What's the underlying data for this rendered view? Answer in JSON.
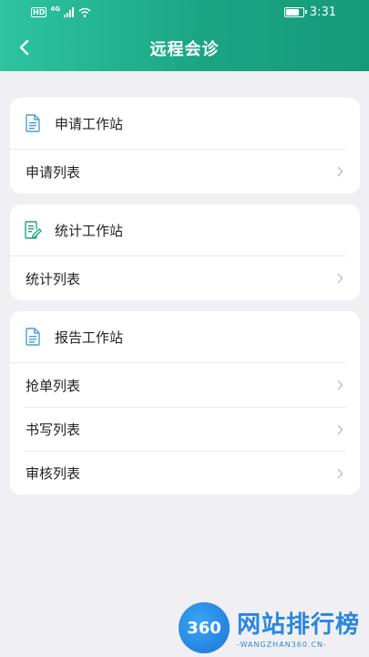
{
  "status_bar": {
    "hd": "HD",
    "network": "4G",
    "time": "3:31"
  },
  "header": {
    "title": "远程会诊"
  },
  "sections": [
    {
      "title": "申请工作站",
      "icon": "document-icon",
      "items": [
        {
          "label": "申请列表"
        }
      ]
    },
    {
      "title": "统计工作站",
      "icon": "edit-document-icon",
      "items": [
        {
          "label": "统计列表"
        }
      ]
    },
    {
      "title": "报告工作站",
      "icon": "document-icon",
      "items": [
        {
          "label": "抢单列表"
        },
        {
          "label": "书写列表"
        },
        {
          "label": "审核列表"
        }
      ]
    }
  ],
  "watermark": {
    "logo": "360",
    "title": "网站排行榜",
    "subtitle": "-WANGZHAN360.CN-"
  },
  "colors": {
    "header_start": "#2ec4a0",
    "header_end": "#179a7a",
    "icon_blue": "#4a9fd8",
    "icon_green": "#1ea57f",
    "background": "#f0f0f4"
  }
}
